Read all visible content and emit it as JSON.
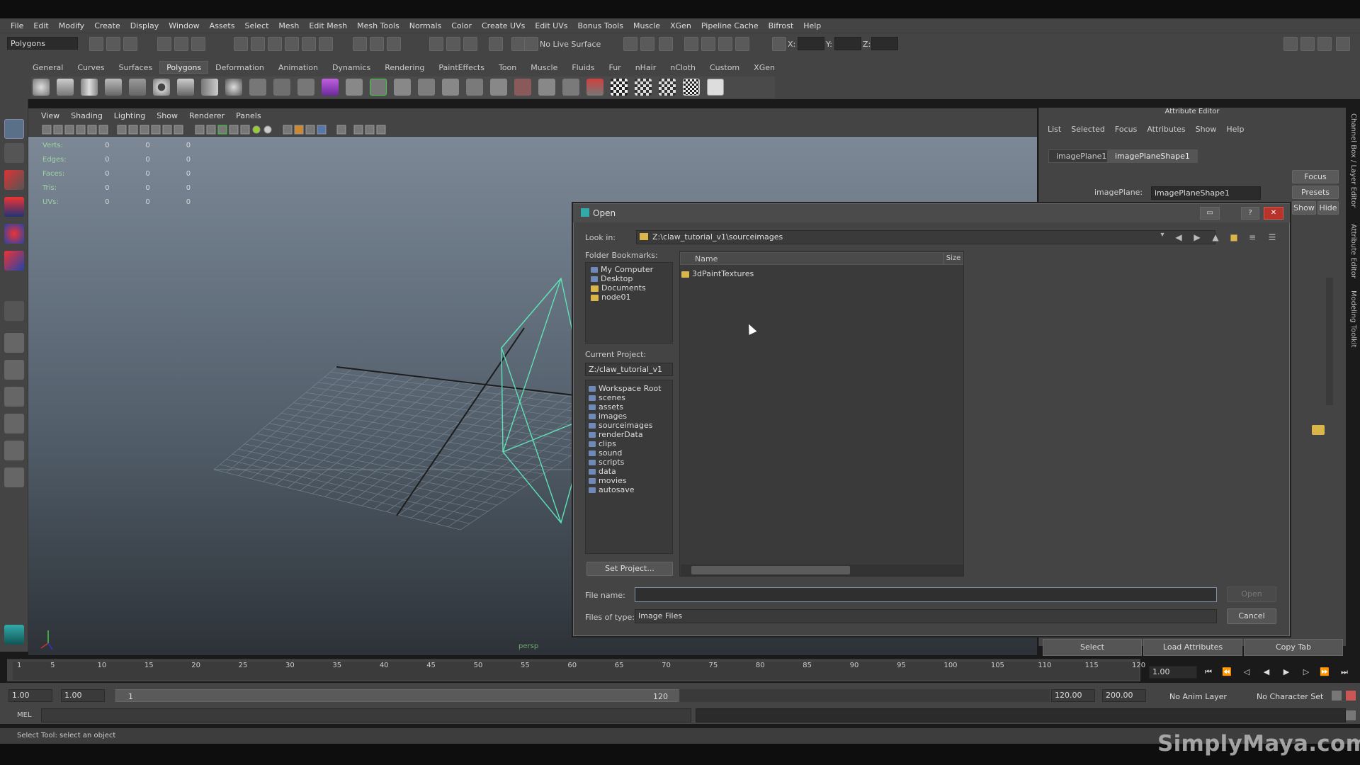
{
  "menubar": [
    "File",
    "Edit",
    "Modify",
    "Create",
    "Display",
    "Window",
    "Assets",
    "Select",
    "Mesh",
    "Edit Mesh",
    "Mesh Tools",
    "Normals",
    "Color",
    "Create UVs",
    "Edit UVs",
    "Bonus Tools",
    "Muscle",
    "XGen",
    "Pipeline Cache",
    "Bifrost",
    "Help"
  ],
  "statusline": {
    "mode": "Polygons",
    "live_surface": "No Live Surface",
    "x_label": "X:",
    "y_label": "Y:",
    "z_label": "Z:"
  },
  "shelf_tabs": [
    "General",
    "Curves",
    "Surfaces",
    "Polygons",
    "Deformation",
    "Animation",
    "Dynamics",
    "Rendering",
    "PaintEffects",
    "Toon",
    "Muscle",
    "Fluids",
    "Fur",
    "nHair",
    "nCloth",
    "Custom",
    "XGen"
  ],
  "viewport": {
    "menu": [
      "View",
      "Shading",
      "Lighting",
      "Show",
      "Renderer",
      "Panels"
    ],
    "hud": [
      {
        "label": "Verts:",
        "a": "0",
        "b": "0",
        "c": "0"
      },
      {
        "label": "Edges:",
        "a": "0",
        "b": "0",
        "c": "0"
      },
      {
        "label": "Faces:",
        "a": "0",
        "b": "0",
        "c": "0"
      },
      {
        "label": "Tris:",
        "a": "0",
        "b": "0",
        "c": "0"
      },
      {
        "label": "UVs:",
        "a": "0",
        "b": "0",
        "c": "0"
      }
    ],
    "camera_label": "persp"
  },
  "attribute_editor": {
    "title": "Attribute Editor",
    "menu": [
      "List",
      "Selected",
      "Focus",
      "Attributes",
      "Show",
      "Help"
    ],
    "tabs": [
      "imagePlane1",
      "imagePlaneShape1"
    ],
    "focus_btn": "Focus",
    "presets_btn": "Presets",
    "show_btn": "Show",
    "hide_btn": "Hide",
    "imageplane_label": "imagePlane:",
    "imageplane_value": "imagePlaneShape1",
    "select_btn": "Select",
    "load_attr_btn": "Load Attributes",
    "copy_tab_btn": "Copy Tab",
    "side_labels": [
      "Channel Box / Layer Editor",
      "Attribute Editor",
      "Modeling Toolkit"
    ]
  },
  "dialog": {
    "title": "Open",
    "look_in_label": "Look in:",
    "look_in_value": "Z:\\claw_tutorial_v1\\sourceimages",
    "bookmarks_label": "Folder Bookmarks:",
    "bookmarks": [
      "My Computer",
      "Desktop",
      "Documents",
      "node01"
    ],
    "current_project_label": "Current Project:",
    "current_project_value": "Z:/claw_tutorial_v1",
    "project_folders": [
      "Workspace Root",
      "scenes",
      "assets",
      "images",
      "sourceimages",
      "renderData",
      "clips",
      "sound",
      "scripts",
      "data",
      "movies",
      "autosave"
    ],
    "set_project_btn": "Set Project...",
    "col_name": "Name",
    "col_size": "Size",
    "files": [
      "3dPaintTextures"
    ],
    "file_name_label": "File name:",
    "file_name_value": "",
    "files_of_type_label": "Files of type:",
    "files_of_type_value": "Image Files",
    "open_btn": "Open",
    "cancel_btn": "Cancel"
  },
  "timeline": {
    "ticks": [
      "1",
      "5",
      "10",
      "15",
      "20",
      "25",
      "30",
      "35",
      "40",
      "45",
      "50",
      "55",
      "60",
      "65",
      "70",
      "75",
      "80",
      "85",
      "90",
      "95",
      "100",
      "105",
      "110",
      "115",
      "120"
    ],
    "current_frame": "1.00"
  },
  "range": {
    "start": "1.00",
    "playback_start": "1.00",
    "slider_start": "1",
    "slider_end": "120",
    "playback_end": "120.00",
    "end": "200.00",
    "anim_layer": "No Anim Layer",
    "character_set": "No Character Set"
  },
  "command_line": {
    "label": "MEL"
  },
  "help_line": "Select Tool: select an object",
  "watermark": "SimplyMaya.com"
}
